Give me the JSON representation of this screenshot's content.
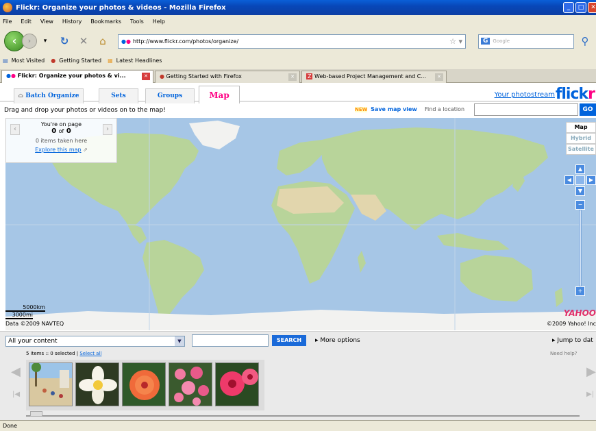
{
  "window": {
    "title": "Flickr: Organize your photos & videos - Mozilla Firefox"
  },
  "menu": [
    "File",
    "Edit",
    "View",
    "History",
    "Bookmarks",
    "Tools",
    "Help"
  ],
  "nav": {
    "url": "http://www.flickr.com/photos/organize/",
    "search_placeholder": "Google",
    "search_engine": "G"
  },
  "bookmarks": [
    "Most Visited",
    "Getting Started",
    "Latest Headlines"
  ],
  "tabs": [
    {
      "label": "Flickr: Organize your photos & vi..."
    },
    {
      "label": "Getting Started with Firefox"
    },
    {
      "label": "Web-based Project Management and C..."
    }
  ],
  "organizr": {
    "tabs": [
      "Batch Organize",
      "Sets",
      "Groups",
      "Map"
    ],
    "photostream_link": "Your photostream",
    "logo_main": "flick",
    "logo_end": "r"
  },
  "toolbar": {
    "instruction": "Drag and drop your photos or videos on to the map!",
    "new_badge": "NEW",
    "save_map_view": "Save map view",
    "find_location": "Find a location",
    "go": "GO"
  },
  "map": {
    "page_line1": "You're on page",
    "page_current": "0",
    "page_of": "of",
    "page_total": "0",
    "items_taken": "0 items taken here",
    "explore": "Explore this map",
    "types": [
      "Map",
      "Hybrid",
      "Satellite"
    ],
    "scale_km": "5000km",
    "scale_mi": "3000mi",
    "copyright_left": "Data ©2009 NAVTEQ",
    "yahoo": "YAHOO",
    "copyright_right": "©2009 Yahoo! Inc",
    "colors": {
      "ocean": "#a6c6e6",
      "land": "#b8d49a",
      "ice": "#f2f2f0",
      "desert": "#e2d6ad"
    }
  },
  "lower": {
    "content_select": "All your content",
    "search_button": "SEARCH",
    "more_options": "More options",
    "jump_to": "Jump to dat",
    "selection_info": "5 items :: 0 selected |",
    "select_all": "Select all",
    "need_help": "Need help?"
  },
  "photos": [
    {
      "name": "beach-photo"
    },
    {
      "name": "white-plumeria-photo"
    },
    {
      "name": "orange-hibiscus-photo"
    },
    {
      "name": "pink-flowers-photo"
    },
    {
      "name": "pink-hibiscus-photo"
    }
  ],
  "status": {
    "text": "Done"
  }
}
